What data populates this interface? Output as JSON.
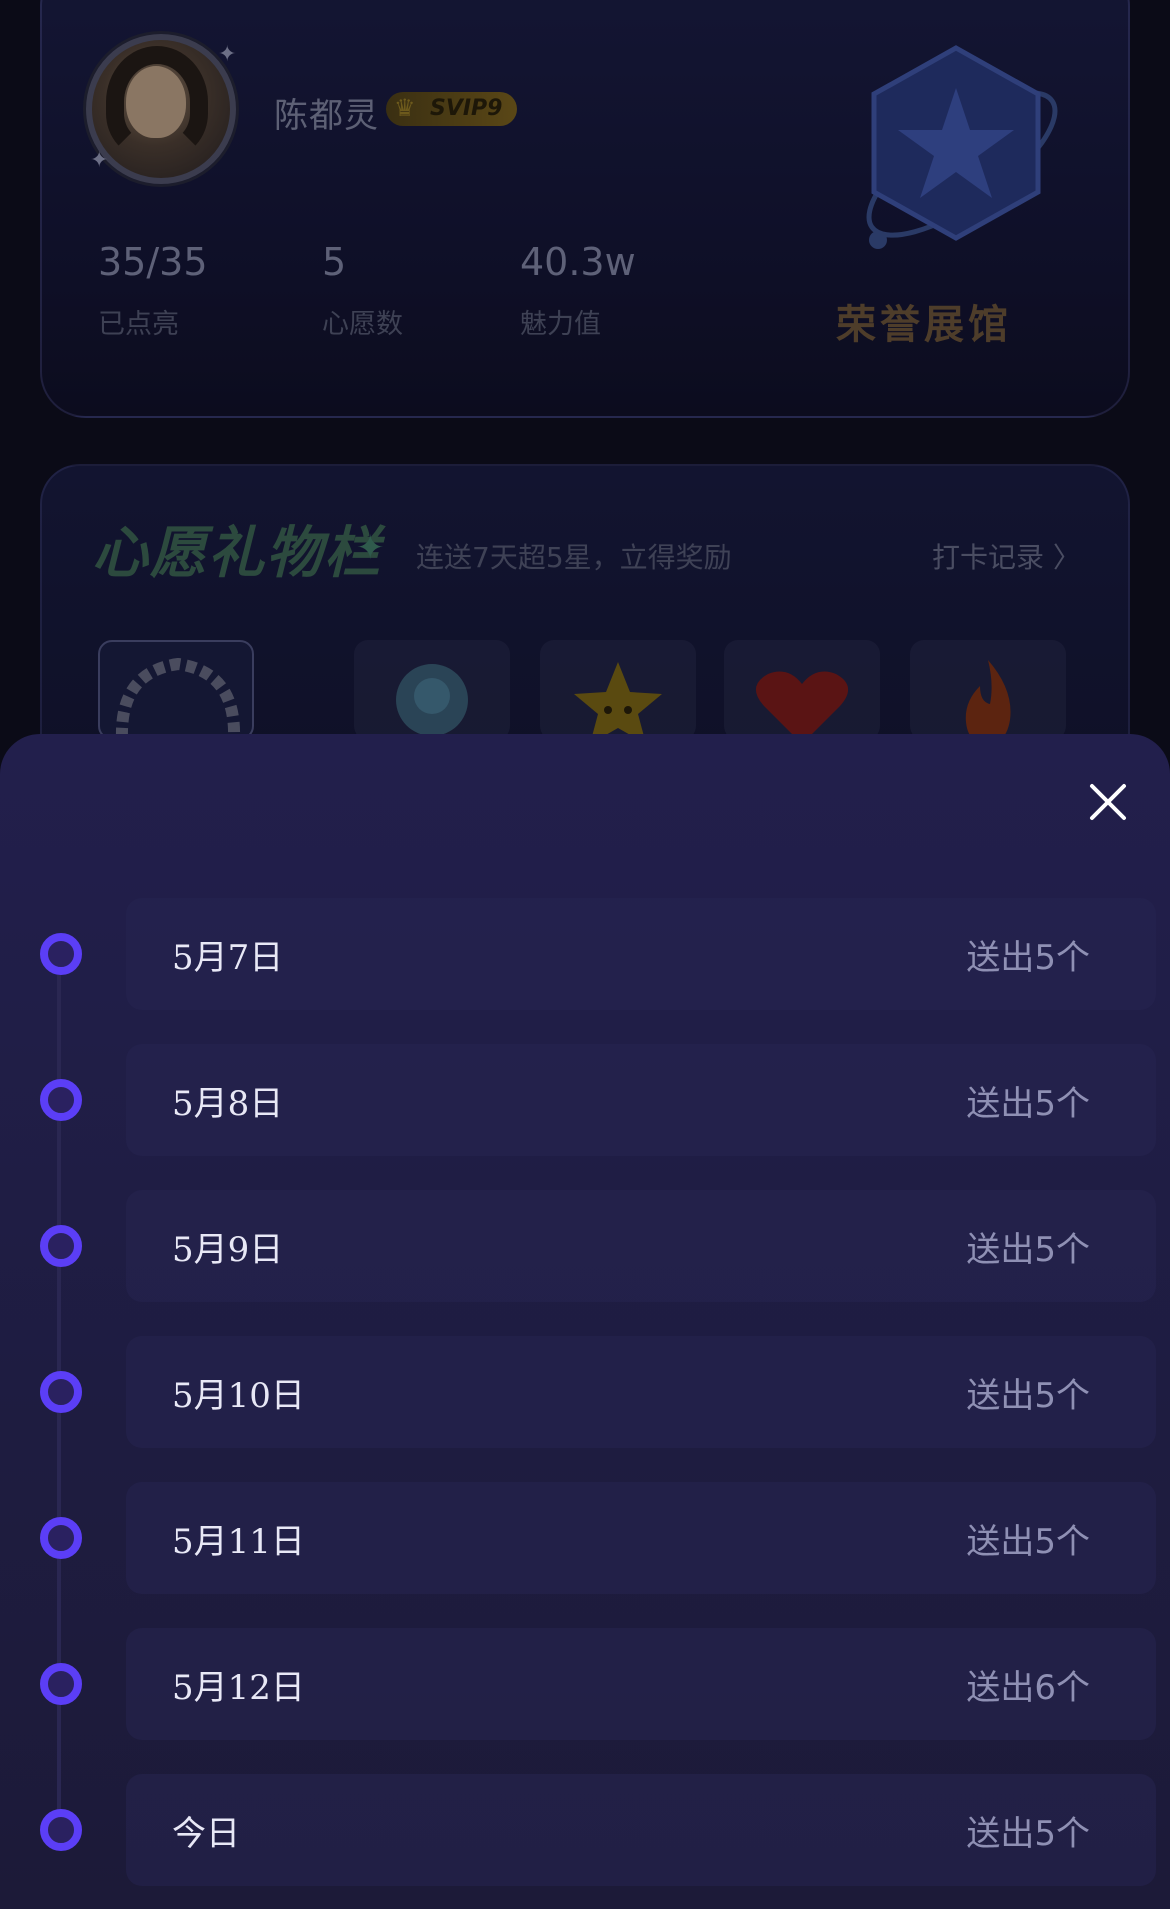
{
  "profile": {
    "name": "陈都灵",
    "vip_label": "SVIP9",
    "stats": [
      {
        "value": "35/35",
        "label": "已点亮"
      },
      {
        "value": "5",
        "label": "心愿数"
      },
      {
        "value": "40.3w",
        "label": "魅力值"
      }
    ],
    "honor_label": "荣誉展馆"
  },
  "wish": {
    "title": "心愿礼物栏",
    "subtitle": "连送7天超5星，立得奖励",
    "checkin_link": "打卡记录 〉"
  },
  "sheet": {
    "title": "",
    "close_icon": "close-icon",
    "accent_color": "#5b3ef6",
    "records": [
      {
        "date": "5月7日",
        "count": "送出5个"
      },
      {
        "date": "5月8日",
        "count": "送出5个"
      },
      {
        "date": "5月9日",
        "count": "送出5个"
      },
      {
        "date": "5月10日",
        "count": "送出5个"
      },
      {
        "date": "5月11日",
        "count": "送出5个"
      },
      {
        "date": "5月12日",
        "count": "送出6个"
      },
      {
        "date": "今日",
        "count": "送出5个"
      }
    ]
  }
}
